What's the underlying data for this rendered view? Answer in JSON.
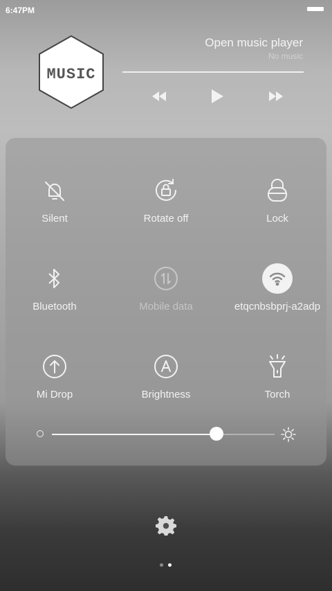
{
  "status_bar": {
    "time": "6:47PM"
  },
  "music": {
    "logo_text": "MUSIC",
    "title": "Open music player",
    "subtitle": "No music",
    "progress": 0.0
  },
  "toggles": [
    {
      "label": "Silent",
      "icon": "bell-off-icon",
      "active": false,
      "dim": false
    },
    {
      "label": "Rotate off",
      "icon": "rotate-lock-icon",
      "active": false,
      "dim": false
    },
    {
      "label": "Lock",
      "icon": "lock-icon",
      "active": false,
      "dim": false
    },
    {
      "label": "Bluetooth",
      "icon": "bluetooth-icon",
      "active": false,
      "dim": false
    },
    {
      "label": "Mobile data",
      "icon": "mobile-data-icon",
      "active": false,
      "dim": true
    },
    {
      "label": "etqcnbsbprj-a2adp",
      "icon": "wifi-icon",
      "active": true,
      "dim": false
    },
    {
      "label": "Mi Drop",
      "icon": "mi-drop-icon",
      "active": false,
      "dim": false
    },
    {
      "label": "Brightness",
      "icon": "brightness-auto-icon",
      "active": false,
      "dim": false
    },
    {
      "label": "Torch",
      "icon": "torch-icon",
      "active": false,
      "dim": false
    }
  ],
  "brightness": {
    "level": 0.74
  },
  "pager": {
    "pages": 2,
    "current": 1
  }
}
